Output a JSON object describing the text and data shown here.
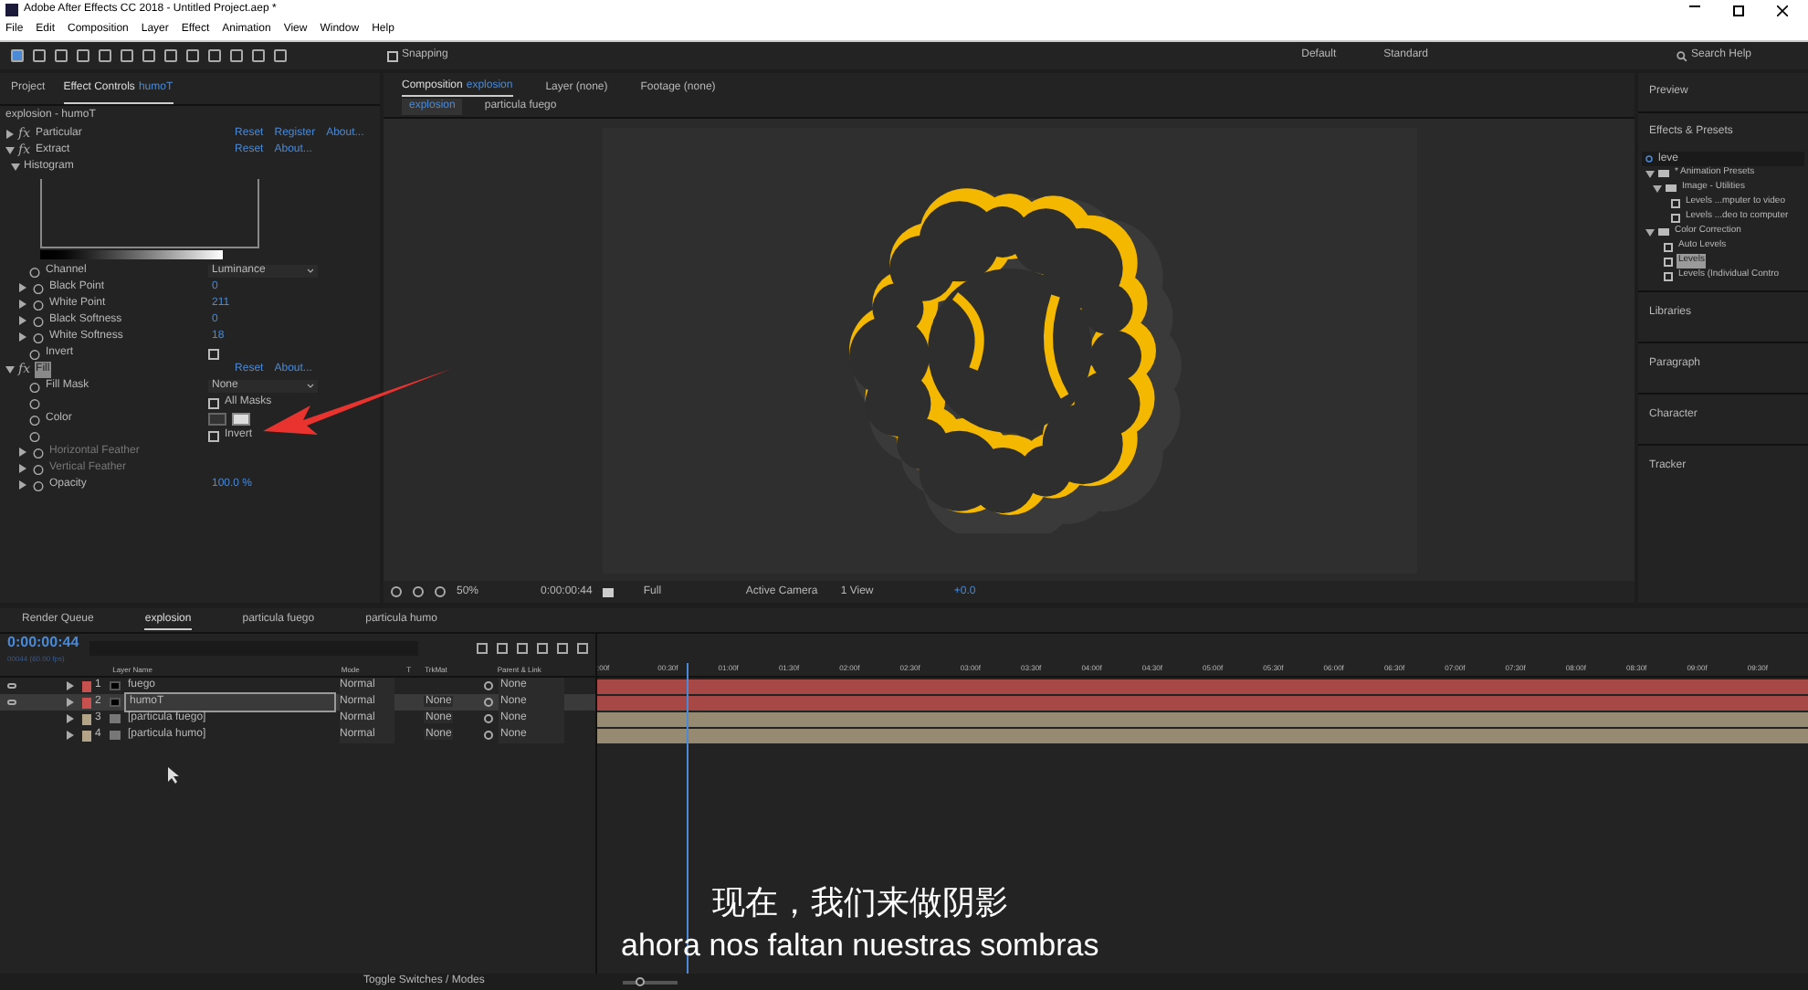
{
  "window": {
    "title": "Adobe After Effects CC 2018 - Untitled Project.aep *"
  },
  "menu": [
    "File",
    "Edit",
    "Composition",
    "Layer",
    "Effect",
    "Animation",
    "View",
    "Window",
    "Help"
  ],
  "toolbar": {
    "snapping": {
      "label": "Snapping",
      "checked": false
    },
    "workspaces": [
      {
        "label": "Default",
        "selected": false
      },
      {
        "label": "Standard",
        "selected": false
      }
    ],
    "search": "Search Help"
  },
  "left_panel": {
    "tabs": [
      {
        "label": "Project",
        "selected": false
      },
      {
        "label": "Effect Controls",
        "target": "humoT",
        "selected": true
      }
    ],
    "layer_title": "explosion - humoT",
    "rows": [
      {
        "kind": "effect",
        "badge": "fx",
        "label": "Particular",
        "expanded": false,
        "highlighted": false,
        "links": [
          "Reset",
          "Register",
          "About..."
        ]
      },
      {
        "kind": "effect",
        "badge": "fx",
        "label": "Extract",
        "expanded": true,
        "highlighted": false,
        "links": [
          "Reset",
          "About..."
        ]
      },
      {
        "kind": "group",
        "label": "Histogram",
        "expanded": true
      },
      {
        "kind": "histogram"
      },
      {
        "kind": "dropdown",
        "label": "Channel",
        "value": "Luminance"
      },
      {
        "kind": "value",
        "label": "Black Point",
        "value": "0"
      },
      {
        "kind": "value",
        "label": "White Point",
        "value": "211"
      },
      {
        "kind": "value",
        "label": "Black Softness",
        "value": "0"
      },
      {
        "kind": "value",
        "label": "White Softness",
        "value": "18"
      },
      {
        "kind": "checkbox",
        "label": "Invert",
        "checked": false
      },
      {
        "kind": "effect",
        "badge": "fx",
        "label": "Fill",
        "expanded": true,
        "highlighted": true,
        "links": [
          "Reset",
          "About..."
        ]
      },
      {
        "kind": "dropdown",
        "label": "Fill Mask",
        "value": "None"
      },
      {
        "kind": "checkbox",
        "side_label": "All Masks",
        "checked": false
      },
      {
        "kind": "color",
        "label": "Color"
      },
      {
        "kind": "checkbox",
        "side_label": "Invert",
        "checked": false
      },
      {
        "kind": "disabled",
        "label": "Horizontal Feather"
      },
      {
        "kind": "disabled",
        "label": "Vertical Feather"
      },
      {
        "kind": "value",
        "label": "Opacity",
        "value": "100.0 %"
      }
    ]
  },
  "composition": {
    "tabs": [
      {
        "label": "Composition",
        "target": "explosion",
        "selected": true
      },
      {
        "label": "Layer (none)",
        "selected": false
      },
      {
        "label": "Footage (none)",
        "selected": false
      }
    ],
    "subtabs": [
      {
        "label": "explosion",
        "selected": true
      },
      {
        "label": "particula fuego",
        "selected": false
      }
    ],
    "footer": {
      "zoom": "50%",
      "timecode": "0:00:00:44",
      "resolution": "Full",
      "camera": "Active Camera",
      "views": "1 View",
      "exposure": "+0.0"
    }
  },
  "right_panel": {
    "preview": "Preview",
    "effects_title": "Effects & Presets",
    "search": "leve",
    "tree": [
      {
        "label": "* Animation Presets",
        "expanded": true,
        "children": [
          {
            "label": "Image - Utilities",
            "expanded": true,
            "children": [
              {
                "label": "Levels ...mputer to video",
                "selected": false
              },
              {
                "label": "Levels ...deo to computer",
                "selected": false
              }
            ]
          }
        ]
      },
      {
        "label": "Color Correction",
        "expanded": true,
        "children": [
          {
            "label": "Auto Levels",
            "selected": false
          },
          {
            "label": "Levels",
            "selected": true
          },
          {
            "label": "Levels (Individual Contro",
            "selected": false
          }
        ]
      }
    ],
    "sections": [
      "Libraries",
      "Paragraph",
      "Character",
      "Tracker"
    ]
  },
  "timeline": {
    "tabs": [
      {
        "label": "Render Queue",
        "selected": false
      },
      {
        "label": "explosion",
        "selected": true
      },
      {
        "label": "particula fuego",
        "selected": false
      },
      {
        "label": "particula humo",
        "selected": false
      }
    ],
    "timecode": "0:00:00:44",
    "frame_info": "00044 (60.00 fps)",
    "columns": [
      "Layer Name",
      "Mode",
      "T",
      "TrkMat",
      "Parent & Link"
    ],
    "layers": [
      {
        "index": "1",
        "name": "fuego",
        "color": "#c8504f",
        "visible": true,
        "selected": false,
        "kind": "solid",
        "mode": "Normal",
        "parent": "None"
      },
      {
        "index": "2",
        "name": "humoT",
        "color": "#c8504f",
        "visible": true,
        "selected": true,
        "kind": "solid",
        "mode": "Normal",
        "trkmat": "None",
        "parent": "None"
      },
      {
        "index": "3",
        "name": "[particula fuego]",
        "color": "#b4a487",
        "visible": false,
        "selected": false,
        "kind": "comp",
        "mode": "Normal",
        "trkmat": "None",
        "parent": "None"
      },
      {
        "index": "4",
        "name": "[particula humo]",
        "color": "#b4a487",
        "visible": false,
        "selected": false,
        "kind": "comp",
        "mode": "Normal",
        "trkmat": "None",
        "parent": "None"
      }
    ],
    "ruler": [
      ":00f",
      "00:30f",
      "01:00f",
      "01:30f",
      "02:00f",
      "02:30f",
      "03:00f",
      "03:30f",
      "04:00f",
      "04:30f",
      "05:00f",
      "05:30f",
      "06:00f",
      "06:30f",
      "07:00f",
      "07:30f",
      "08:00f",
      "08:30f",
      "09:00f",
      "09:30f"
    ],
    "playhead": {
      "level": 0.074
    },
    "footer": "Toggle Switches / Modes",
    "zoom_slider": {
      "level": 0.3
    }
  },
  "subtitles": [
    "现在，我们来做阴影",
    "ahora nos faltan nuestras sombras"
  ]
}
